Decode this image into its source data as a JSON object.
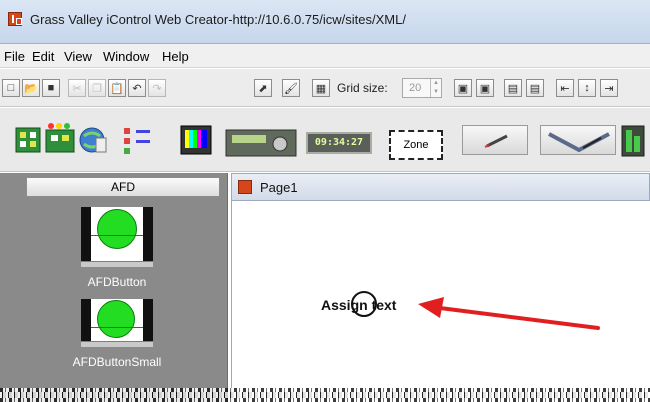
{
  "window": {
    "title": "Grass Valley iControl Web Creator-http://10.6.0.75/icw/sites/XML/"
  },
  "menu": [
    "File",
    "Edit",
    "View",
    "Window",
    "Help"
  ],
  "toolbar": {
    "icons": [
      "new-document-icon",
      "open-folder-icon",
      "save-icon",
      "cut-icon",
      "copy-icon",
      "paste-icon",
      "undo-icon",
      "redo-icon",
      "pointer-icon",
      "brush-icon",
      "grid-toggle-icon",
      "bring-forward-icon",
      "send-backward-icon",
      "group-icon",
      "ungroup-icon",
      "align-left-icon",
      "align-center-icon",
      "align-right-icon"
    ],
    "grid_size_label": "Grid size:",
    "grid_size_value": "20"
  },
  "widgets": {
    "clock_text": "09:34:27",
    "zone_label": "Zone"
  },
  "palette": {
    "header": "AFD",
    "items": [
      {
        "label": "AFDButton"
      },
      {
        "label": "AFDButtonSmall"
      }
    ]
  },
  "page": {
    "tab_title": "Page1",
    "assign_text": "Assign text"
  },
  "colors": {
    "arrow": "#e02020",
    "afd_circle": "#22dd22"
  }
}
